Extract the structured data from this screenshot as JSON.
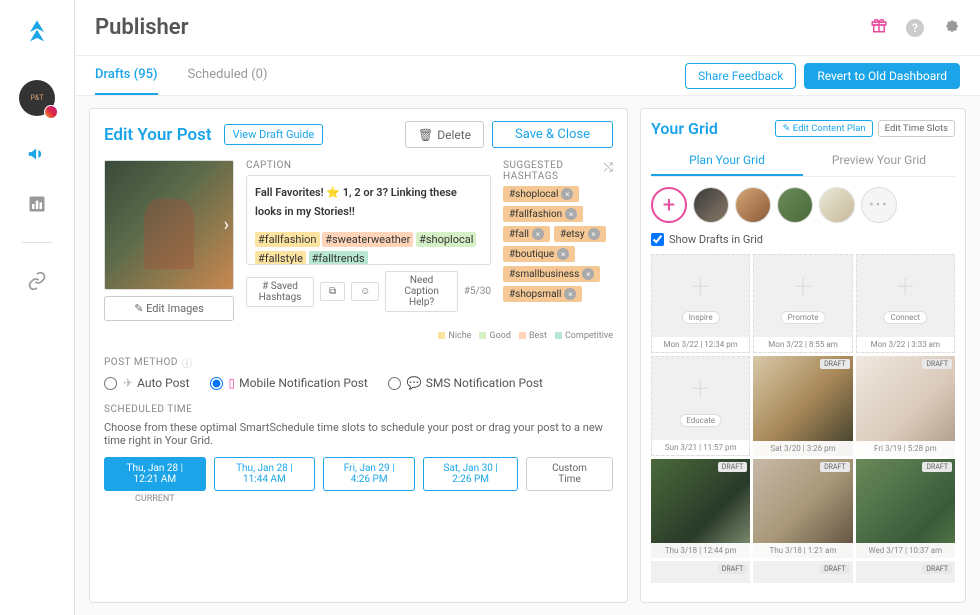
{
  "header": {
    "title": "Publisher"
  },
  "topicons": {
    "gift": "🎁",
    "help": "?",
    "settings": "⚙"
  },
  "tabs": {
    "drafts": "Drafts (95)",
    "scheduled": "Scheduled (0)",
    "share_feedback": "Share Feedback",
    "revert": "Revert to Old Dashboard"
  },
  "edit": {
    "title": "Edit Your Post",
    "view_guide": "View Draft Guide",
    "delete": "Delete",
    "save": "Save & Close",
    "edit_images": "✎ Edit Images",
    "caption_label": "CAPTION",
    "suggested_label": "SUGGESTED HASHTAGS",
    "caption_text": "Fall Favorites! ⭐ 1, 2 or 3? Linking these looks in my Stories!!",
    "hashtags_inline": [
      {
        "t": "#fallfashion",
        "c": "n"
      },
      {
        "t": "#sweaterweather",
        "c": "b"
      },
      {
        "t": "#shoplocal",
        "c": "g"
      },
      {
        "t": "#fallstyle",
        "c": "n"
      },
      {
        "t": "#falltrends",
        "c": "c"
      }
    ],
    "saved_hashtags": "# Saved Hashtags",
    "need_help": "Need Caption Help?",
    "counter": "#5/30",
    "suggested_chips": [
      "#shoplocal",
      "#fallfashion",
      "#fall",
      "#etsy",
      "#boutique",
      "#smallbusiness",
      "#shopsmall"
    ],
    "legend": {
      "niche": "Niche",
      "good": "Good",
      "best": "Best",
      "comp": "Competitive"
    }
  },
  "post_method": {
    "label": "POST METHOD",
    "auto": "Auto Post",
    "mobile": "Mobile Notification Post",
    "sms": "SMS Notification Post"
  },
  "schedule": {
    "label": "SCHEDULED TIME",
    "desc": "Choose from these optimal SmartSchedule time slots to schedule your post or drag your post to a new time right in Your Grid.",
    "slots": [
      {
        "text": "Thu, Jan 28 | 12:21 AM",
        "current": "CURRENT",
        "active": true
      },
      {
        "text": "Thu, Jan 28 | 11:44 AM"
      },
      {
        "text": "Fri, Jan 29 | 4:26 PM"
      },
      {
        "text": "Sat, Jan 30 | 2:26 PM"
      }
    ],
    "custom": "Custom Time"
  },
  "grid": {
    "title": "Your Grid",
    "edit_plan": "✎ Edit Content Plan",
    "edit_slots": "Edit Time Slots",
    "tab_plan": "Plan Your Grid",
    "tab_preview": "Preview Your Grid",
    "show_drafts": "Show Drafts in Grid",
    "draft_badge": "DRAFT",
    "cells": [
      {
        "type": "empty",
        "cat": "Inspire",
        "foot": "Mon 3/22 | 12:34 pm"
      },
      {
        "type": "empty",
        "cat": "Promote",
        "foot": "Mon 3/22 | 8:55 am"
      },
      {
        "type": "empty",
        "cat": "Connect",
        "foot": "Mon 3/22 | 3:33 am"
      },
      {
        "type": "empty",
        "cat": "Educate",
        "foot": "Sun 3/21 | 11:57 pm"
      },
      {
        "type": "photo",
        "ph": "ph1",
        "foot": "Sat 3/20 | 3:26 pm",
        "draft": true
      },
      {
        "type": "photo",
        "ph": "ph2",
        "foot": "Fri 3/19 | 5:28 pm",
        "draft": true
      },
      {
        "type": "photo",
        "ph": "ph3",
        "foot": "Thu 3/18 | 12:44 pm",
        "draft": true
      },
      {
        "type": "photo",
        "ph": "ph4",
        "foot": "Thu 3/18 | 1:21 am",
        "draft": true
      },
      {
        "type": "photo",
        "ph": "ph5",
        "foot": "Wed 3/17 | 10:37 am",
        "draft": true
      },
      {
        "type": "stub",
        "draft": true
      },
      {
        "type": "stub",
        "draft": true
      },
      {
        "type": "stub",
        "draft": true
      }
    ]
  }
}
